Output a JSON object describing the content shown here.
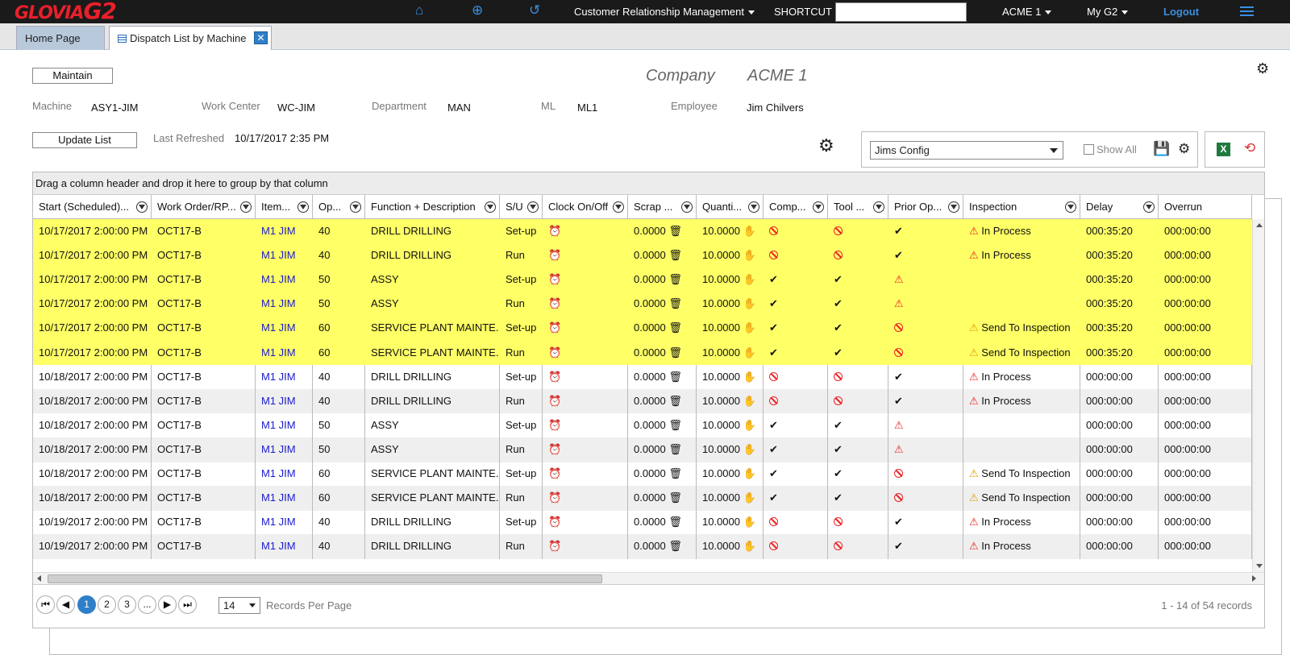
{
  "app": {
    "logo": "GLOVIA",
    "logo_suffix": "G2",
    "menu": "Customer Relationship Management",
    "shortcut_label": "SHORTCUT",
    "shortcut_value": "",
    "company_menu": "ACME 1",
    "myg2": "My G2",
    "logout": "Logout",
    "accent": "#3a8fe0",
    "brand_red": "#e8202a"
  },
  "tabs": [
    {
      "label": "Home Page"
    },
    {
      "label": "Dispatch List by Machine"
    }
  ],
  "header": {
    "maintain": "Maintain",
    "company_label": "Company",
    "company_value": "ACME 1",
    "machine_label": "Machine",
    "machine_value": "ASY1-JIM",
    "workcenter_label": "Work Center",
    "workcenter_value": "WC-JIM",
    "department_label": "Department",
    "department_value": "MAN",
    "ml_label": "ML",
    "ml_value": "ML1",
    "employee_label": "Employee",
    "employee_value": "Jim Chilvers",
    "update_list": "Update List",
    "last_refreshed_label": "Last Refreshed",
    "last_refreshed_value": "10/17/2017 2:35 PM"
  },
  "config": {
    "selected": "Jims Config",
    "show_all": "Show All"
  },
  "grid": {
    "group_hint": "Drag a column header and drop it here to group by that column",
    "columns": [
      "Start (Scheduled)...",
      "Work Order/RP...",
      "Item...",
      "Op...",
      "Function + Description",
      "S/U",
      "Clock On/Off",
      "Scrap ...",
      "Quanti...",
      "Comp...",
      "Tool ...",
      "Prior Op...",
      "Inspection",
      "Delay",
      "Overrun"
    ],
    "rows": [
      {
        "start": "10/17/2017 2:00:00 PM",
        "wo": "OCT17-B",
        "item": "M1 JIM",
        "op": "40",
        "func": "DRILL DRILLING",
        "su": "Set-up",
        "scrap": "0.0000",
        "qty": "10.0000",
        "comp": "block",
        "tool": "block",
        "prior": "check",
        "insp_icon": "warn",
        "insp": "In Process",
        "delay": "000:35:20",
        "overrun": "000:00:00",
        "hl": true
      },
      {
        "start": "10/17/2017 2:00:00 PM",
        "wo": "OCT17-B",
        "item": "M1 JIM",
        "op": "40",
        "func": "DRILL DRILLING",
        "su": "Run",
        "scrap": "0.0000",
        "qty": "10.0000",
        "comp": "block",
        "tool": "block",
        "prior": "check",
        "insp_icon": "warn",
        "insp": "In Process",
        "delay": "000:35:20",
        "overrun": "000:00:00",
        "hl": true
      },
      {
        "start": "10/17/2017 2:00:00 PM",
        "wo": "OCT17-B",
        "item": "M1 JIM",
        "op": "50",
        "func": "ASSY",
        "su": "Set-up",
        "scrap": "0.0000",
        "qty": "10.0000",
        "comp": "check",
        "tool": "check",
        "prior": "warn",
        "insp_icon": "",
        "insp": "",
        "delay": "000:35:20",
        "overrun": "000:00:00",
        "hl": true
      },
      {
        "start": "10/17/2017 2:00:00 PM",
        "wo": "OCT17-B",
        "item": "M1 JIM",
        "op": "50",
        "func": "ASSY",
        "su": "Run",
        "scrap": "0.0000",
        "qty": "10.0000",
        "comp": "check",
        "tool": "check",
        "prior": "warn",
        "insp_icon": "",
        "insp": "",
        "delay": "000:35:20",
        "overrun": "000:00:00",
        "hl": true
      },
      {
        "start": "10/17/2017 2:00:00 PM",
        "wo": "OCT17-B",
        "item": "M1 JIM",
        "op": "60",
        "func": "SERVICE PLANT MAINTE...",
        "su": "Set-up",
        "scrap": "0.0000",
        "qty": "10.0000",
        "comp": "check",
        "tool": "check",
        "prior": "block",
        "insp_icon": "warn-y",
        "insp": "Send To Inspection",
        "delay": "000:35:20",
        "overrun": "000:00:00",
        "hl": true
      },
      {
        "start": "10/17/2017 2:00:00 PM",
        "wo": "OCT17-B",
        "item": "M1 JIM",
        "op": "60",
        "func": "SERVICE PLANT MAINTE...",
        "su": "Run",
        "scrap": "0.0000",
        "qty": "10.0000",
        "comp": "check",
        "tool": "check",
        "prior": "block",
        "insp_icon": "warn-y",
        "insp": "Send To Inspection",
        "delay": "000:35:20",
        "overrun": "000:00:00",
        "hl": true
      },
      {
        "start": "10/18/2017 2:00:00 PM",
        "wo": "OCT17-B",
        "item": "M1 JIM",
        "op": "40",
        "func": "DRILL DRILLING",
        "su": "Set-up",
        "scrap": "0.0000",
        "qty": "10.0000",
        "comp": "block",
        "tool": "block",
        "prior": "check",
        "insp_icon": "warn",
        "insp": "In Process",
        "delay": "000:00:00",
        "overrun": "000:00:00",
        "hl": false
      },
      {
        "start": "10/18/2017 2:00:00 PM",
        "wo": "OCT17-B",
        "item": "M1 JIM",
        "op": "40",
        "func": "DRILL DRILLING",
        "su": "Run",
        "scrap": "0.0000",
        "qty": "10.0000",
        "comp": "block",
        "tool": "block",
        "prior": "check",
        "insp_icon": "warn",
        "insp": "In Process",
        "delay": "000:00:00",
        "overrun": "000:00:00",
        "hl": false
      },
      {
        "start": "10/18/2017 2:00:00 PM",
        "wo": "OCT17-B",
        "item": "M1 JIM",
        "op": "50",
        "func": "ASSY",
        "su": "Set-up",
        "scrap": "0.0000",
        "qty": "10.0000",
        "comp": "check",
        "tool": "check",
        "prior": "warn",
        "insp_icon": "",
        "insp": "",
        "delay": "000:00:00",
        "overrun": "000:00:00",
        "hl": false
      },
      {
        "start": "10/18/2017 2:00:00 PM",
        "wo": "OCT17-B",
        "item": "M1 JIM",
        "op": "50",
        "func": "ASSY",
        "su": "Run",
        "scrap": "0.0000",
        "qty": "10.0000",
        "comp": "check",
        "tool": "check",
        "prior": "warn",
        "insp_icon": "",
        "insp": "",
        "delay": "000:00:00",
        "overrun": "000:00:00",
        "hl": false
      },
      {
        "start": "10/18/2017 2:00:00 PM",
        "wo": "OCT17-B",
        "item": "M1 JIM",
        "op": "60",
        "func": "SERVICE PLANT MAINTE...",
        "su": "Set-up",
        "scrap": "0.0000",
        "qty": "10.0000",
        "comp": "check",
        "tool": "check",
        "prior": "block",
        "insp_icon": "warn-y",
        "insp": "Send To Inspection",
        "delay": "000:00:00",
        "overrun": "000:00:00",
        "hl": false
      },
      {
        "start": "10/18/2017 2:00:00 PM",
        "wo": "OCT17-B",
        "item": "M1 JIM",
        "op": "60",
        "func": "SERVICE PLANT MAINTE...",
        "su": "Run",
        "scrap": "0.0000",
        "qty": "10.0000",
        "comp": "check",
        "tool": "check",
        "prior": "block",
        "insp_icon": "warn-y",
        "insp": "Send To Inspection",
        "delay": "000:00:00",
        "overrun": "000:00:00",
        "hl": false
      },
      {
        "start": "10/19/2017 2:00:00 PM",
        "wo": "OCT17-B",
        "item": "M1 JIM",
        "op": "40",
        "func": "DRILL DRILLING",
        "su": "Set-up",
        "scrap": "0.0000",
        "qty": "10.0000",
        "comp": "block",
        "tool": "block",
        "prior": "check",
        "insp_icon": "warn",
        "insp": "In Process",
        "delay": "000:00:00",
        "overrun": "000:00:00",
        "hl": false
      },
      {
        "start": "10/19/2017 2:00:00 PM",
        "wo": "OCT17-B",
        "item": "M1 JIM",
        "op": "40",
        "func": "DRILL DRILLING",
        "su": "Run",
        "scrap": "0.0000",
        "qty": "10.0000",
        "comp": "block",
        "tool": "block",
        "prior": "check",
        "insp_icon": "warn",
        "insp": "In Process",
        "delay": "000:00:00",
        "overrun": "000:00:00",
        "hl": false
      }
    ],
    "highlight_color": "#ffff66"
  },
  "pager": {
    "pages": [
      "1",
      "2",
      "3",
      "..."
    ],
    "current": "1",
    "per_page": "14",
    "per_page_label": "Records Per Page",
    "record_info": "1 - 14 of 54 records"
  }
}
